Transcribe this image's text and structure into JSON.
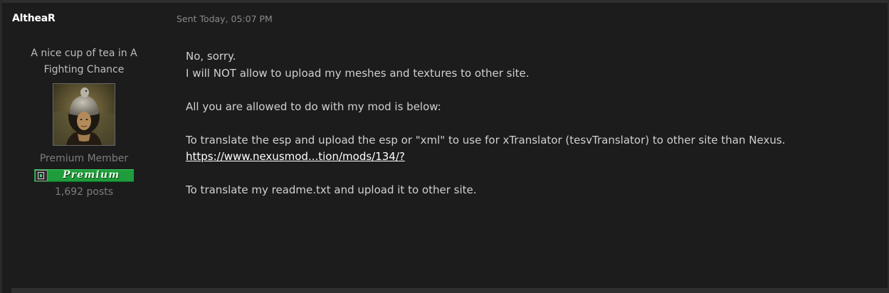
{
  "post": {
    "author": {
      "name": "AltheaR",
      "title": "A nice cup of tea in A Fighting Chance",
      "group": "Premium Member",
      "badge_text": "Premium",
      "post_count": "1,692 posts"
    },
    "date": "Sent Today, 05:07 PM",
    "body": {
      "line1": "No, sorry.",
      "line2": "I will NOT allow to upload my meshes and textures to other site.",
      "line3": "All you are allowed to do with my mod is below:",
      "line4": "To translate the esp and upload the esp or \"xml\" to use for xTranslator (tesvTranslator) to other site than Nexus.",
      "link": "https://www.nexusmod...tion/mods/134/?",
      "line5": "To translate my readme.txt and upload it to other site."
    }
  },
  "colors": {
    "background": "#1c1c1c",
    "text": "#d0d0d0",
    "muted": "#7d7d7d",
    "badge_green": "#1f9c3c"
  },
  "icons": {
    "avatar": "mona-lisa-parody-avatar",
    "badge_emblem": "premium-emblem-icon"
  }
}
